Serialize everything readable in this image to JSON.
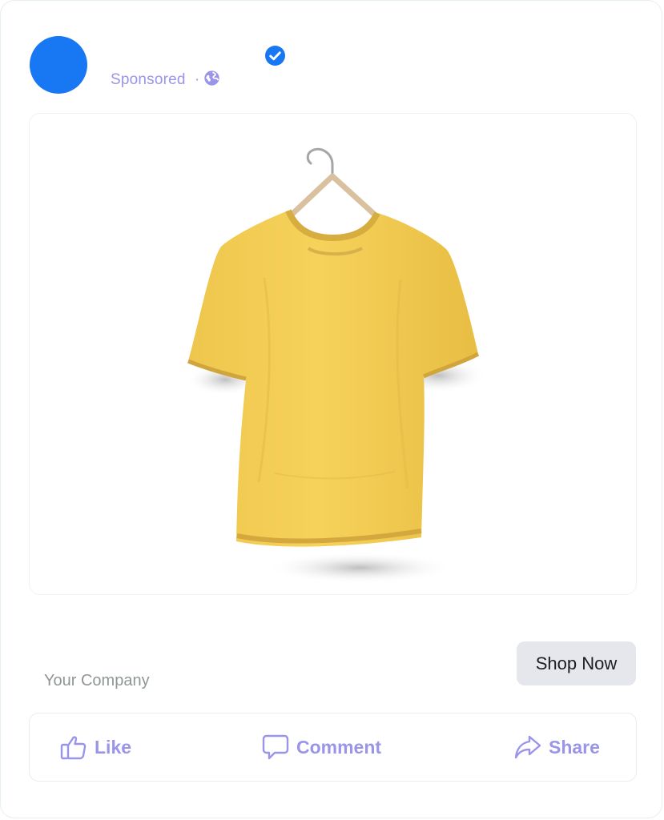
{
  "post": {
    "sponsored_label": "Sponsored",
    "separator": "·",
    "company": "Your Company",
    "cta_label": "Shop Now"
  },
  "actions": {
    "like": "Like",
    "comment": "Comment",
    "share": "Share"
  },
  "colors": {
    "brand_blue": "#1877f2",
    "action_purple": "#9a95e8",
    "shirt_yellow": "#f5cf56",
    "cta_bg": "#e6e7ec"
  },
  "icons": [
    "verified-icon",
    "globe-icon",
    "thumbs-up-icon",
    "comment-icon",
    "share-icon"
  ]
}
